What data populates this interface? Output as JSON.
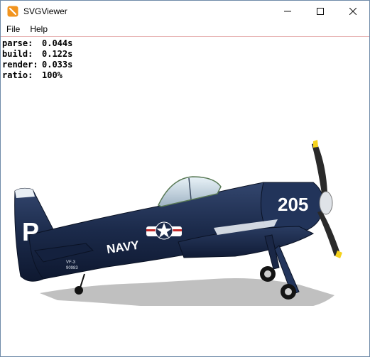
{
  "window": {
    "title": "SVGViewer",
    "icon": "svgviewer-app-icon",
    "controls": [
      "minimize-icon",
      "maximize-icon",
      "close-icon"
    ]
  },
  "menu": {
    "items": [
      {
        "label": "File"
      },
      {
        "label": "Help"
      }
    ]
  },
  "stats": [
    {
      "label": "parse:",
      "value": "0.044s"
    },
    {
      "label": "build:",
      "value": "0.122s"
    },
    {
      "label": "render:",
      "value": "0.033s"
    },
    {
      "label": "ratio:",
      "value": "100%"
    }
  ],
  "artwork": {
    "tail_letter": "P",
    "fuselage_text": "NAVY",
    "cowl_number": "205",
    "serial_top": "VF-3",
    "serial_bottom": "90983"
  },
  "colors": {
    "fuselage": "#1b2a4a",
    "accent_red": "#c42a2a",
    "app_icon": "#f2941e",
    "prop_tip": "#f5d21c"
  }
}
